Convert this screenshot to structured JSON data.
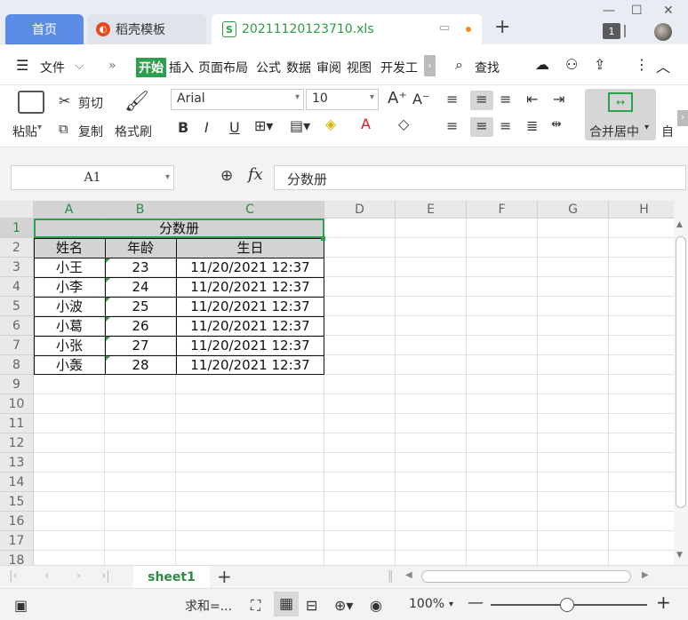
{
  "tabs": {
    "home": "首页",
    "dk_template": "稻壳模板",
    "file": "20211120123710.xls",
    "badge": "1"
  },
  "menu": {
    "file": "文件",
    "items": [
      "开始",
      "插入",
      "页面布局",
      "公式",
      "数据",
      "审阅",
      "视图",
      "开发工"
    ],
    "search": "查找"
  },
  "ribbon": {
    "paste": "粘贴",
    "cut": "剪切",
    "copy": "复制",
    "format_painter": "格式刷",
    "font": "Arial",
    "size": "10",
    "merge": "合并居中",
    "auto": "自"
  },
  "formula": {
    "cell_ref": "A1",
    "fx": "fx",
    "content": "分数册"
  },
  "grid": {
    "columns": [
      "A",
      "B",
      "C",
      "D",
      "E",
      "F",
      "G",
      "H"
    ],
    "rows": [
      "1",
      "2",
      "3",
      "4",
      "5",
      "6",
      "7",
      "8",
      "9",
      "10",
      "11",
      "12",
      "13",
      "14",
      "15",
      "16",
      "17",
      "18"
    ],
    "title": "分数册",
    "headers": [
      "姓名",
      "年龄",
      "生日"
    ],
    "data": [
      [
        "小王",
        "23",
        "11/20/2021 12:37"
      ],
      [
        "小李",
        "24",
        "11/20/2021 12:37"
      ],
      [
        "小波",
        "25",
        "11/20/2021 12:37"
      ],
      [
        "小葛",
        "26",
        "11/20/2021 12:37"
      ],
      [
        "小张",
        "27",
        "11/20/2021 12:37"
      ],
      [
        "小轰",
        "28",
        "11/20/2021 12:37"
      ]
    ]
  },
  "sheets": {
    "active": "sheet1"
  },
  "status": {
    "sum": "求和=...",
    "zoom": "100%"
  }
}
